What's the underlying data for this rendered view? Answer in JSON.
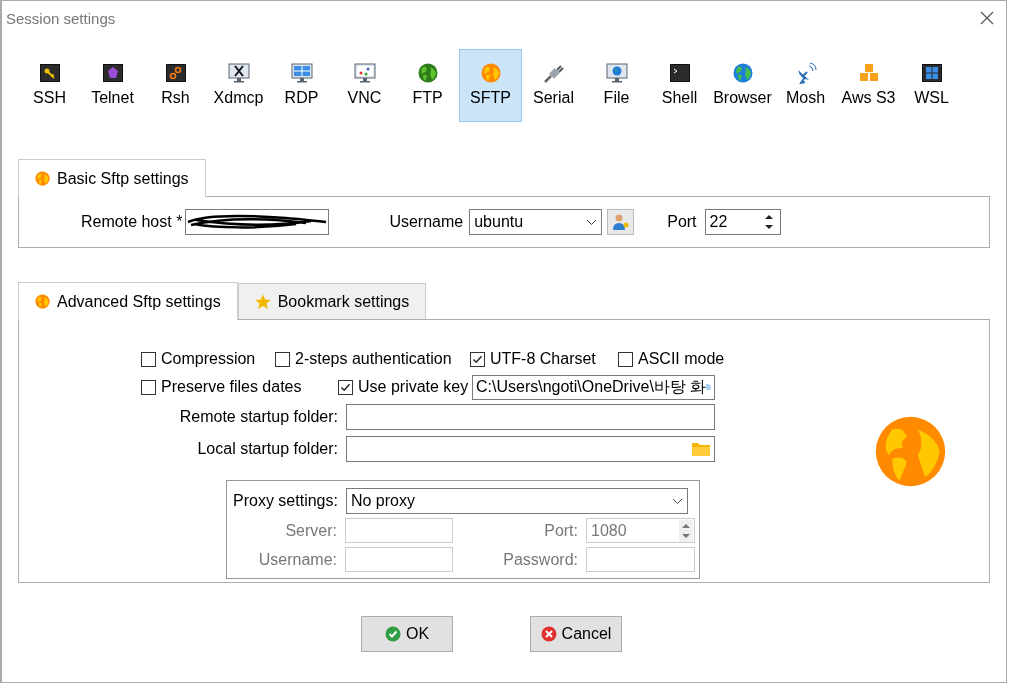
{
  "window": {
    "title": "Session settings"
  },
  "protocols": [
    {
      "label": "SSH",
      "kind": "key",
      "selected": false
    },
    {
      "label": "Telnet",
      "kind": "gem",
      "selected": false
    },
    {
      "label": "Rsh",
      "kind": "gears",
      "selected": false
    },
    {
      "label": "Xdmcp",
      "kind": "xmonitor",
      "selected": false
    },
    {
      "label": "RDP",
      "kind": "winmonitor",
      "selected": false
    },
    {
      "label": "VNC",
      "kind": "vncmonitor",
      "selected": false
    },
    {
      "label": "FTP",
      "kind": "greenglobe",
      "selected": false
    },
    {
      "label": "SFTP",
      "kind": "orangeglobe",
      "selected": true
    },
    {
      "label": "Serial",
      "kind": "plug",
      "selected": false
    },
    {
      "label": "File",
      "kind": "globemonitor",
      "selected": false
    },
    {
      "label": "Shell",
      "kind": "terminal",
      "selected": false
    },
    {
      "label": "Browser",
      "kind": "blueglobe",
      "selected": false
    },
    {
      "label": "Mosh",
      "kind": "dish",
      "selected": false
    },
    {
      "label": "Aws S3",
      "kind": "cubes",
      "selected": false
    },
    {
      "label": "WSL",
      "kind": "windows",
      "selected": false
    }
  ],
  "basic_tab": {
    "label": "Basic Sftp settings",
    "selected": true
  },
  "basic": {
    "remote_host_label": "Remote host *",
    "username_label": "Username",
    "username": "ubuntu",
    "port_label": "Port",
    "port": "22"
  },
  "advanced_tabs": [
    {
      "label": "Advanced Sftp settings",
      "kind": "globe",
      "selected": true
    },
    {
      "label": "Bookmark settings",
      "kind": "star",
      "selected": false
    }
  ],
  "option_rows": [
    [
      {
        "label": "Compression",
        "checked": false
      },
      {
        "label": "2-steps authentication",
        "checked": false
      },
      {
        "label": "UTF-8 Charset",
        "checked": true
      },
      {
        "label": "ASCII mode",
        "checked": false
      }
    ],
    [
      {
        "label": "Preserve files dates",
        "checked": false
      },
      {
        "label": "Use private key",
        "checked": true
      }
    ]
  ],
  "private_key_path": "C:\\Users\\ngoti\\OneDrive\\바탕 화",
  "folders": [
    {
      "label": "Remote startup folder:",
      "kind": "plain"
    },
    {
      "label": "Local startup folder:",
      "kind": "browse"
    }
  ],
  "proxy": {
    "label": "Proxy settings:",
    "value": "No proxy",
    "fields": [
      {
        "label": "Server:",
        "kind": "text",
        "disabled": true
      },
      {
        "label": "Port:",
        "kind": "spin",
        "value": "1080",
        "disabled": true
      },
      {
        "label": "Username:",
        "kind": "text",
        "disabled": true
      },
      {
        "label": "Password:",
        "kind": "text",
        "disabled": true
      }
    ]
  },
  "buttons": [
    {
      "label": "OK",
      "kind": "ok"
    },
    {
      "label": "Cancel",
      "kind": "cancel"
    }
  ]
}
